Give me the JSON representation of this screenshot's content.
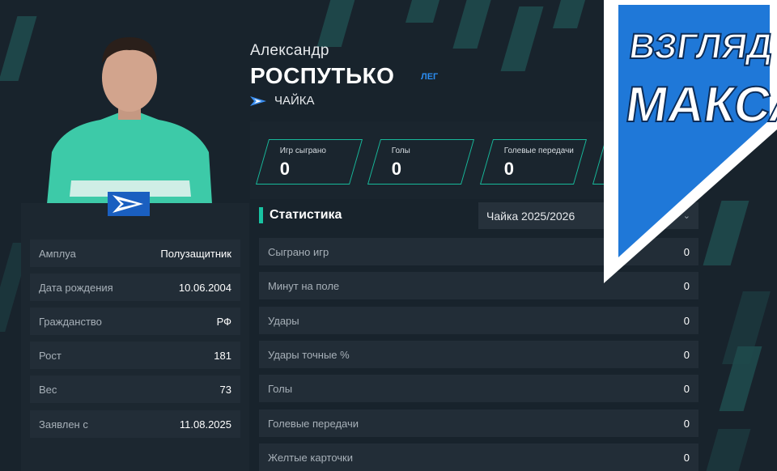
{
  "player": {
    "first_name": "Александр",
    "last_name": "РОСПУТЬКО",
    "position_badge": "ЛЕГ",
    "club": "ЧАЙКА"
  },
  "summary_cards": [
    {
      "label": "Игр сыграно",
      "value": "0"
    },
    {
      "label": "Голы",
      "value": "0"
    },
    {
      "label": "Голевые передачи",
      "value": "0"
    }
  ],
  "info": [
    {
      "label": "Амплуа",
      "value": "Полузащитник"
    },
    {
      "label": "Дата рождения",
      "value": "10.06.2004"
    },
    {
      "label": "Гражданство",
      "value": "РФ"
    },
    {
      "label": "Рост",
      "value": "181"
    },
    {
      "label": "Вес",
      "value": "73"
    },
    {
      "label": "Заявлен с",
      "value": "11.08.2025"
    }
  ],
  "statistics": {
    "title": "Статистика",
    "season": "Чайка 2025/2026",
    "rows": [
      {
        "label": "Сыграно игр",
        "value": "0"
      },
      {
        "label": "Минут на поле",
        "value": "0"
      },
      {
        "label": "Удары",
        "value": "0"
      },
      {
        "label": "Удары точные %",
        "value": "0"
      },
      {
        "label": "Голы",
        "value": "0"
      },
      {
        "label": "Голевые передачи",
        "value": "0"
      },
      {
        "label": "Желтые карточки",
        "value": "0"
      }
    ]
  },
  "watermark": {
    "line1": "ВЗГЛЯД",
    "line2": "МАКСА"
  },
  "icons": {
    "club_logo": "chaika-arrow-icon",
    "select_chevron": "chevron-down-icon"
  },
  "colors": {
    "background": "#18232c",
    "accent_teal": "#17b89a",
    "badge_blue": "#2b8cf0",
    "watermark_blue": "#1f78d8"
  }
}
